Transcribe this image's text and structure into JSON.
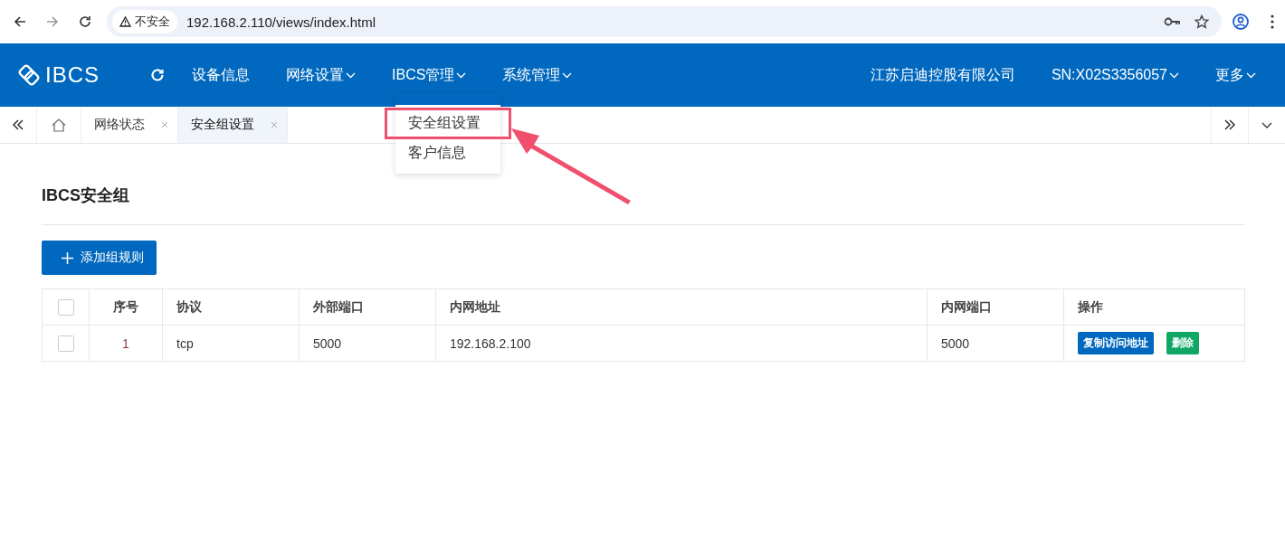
{
  "browser": {
    "security_label": "不安全",
    "url": "192.168.2.110/views/index.html"
  },
  "nav": {
    "logo": "IBCS",
    "items": [
      {
        "label": "设备信息",
        "has_menu": false
      },
      {
        "label": "网络设置",
        "has_menu": true
      },
      {
        "label": "IBCS管理",
        "has_menu": true
      },
      {
        "label": "系统管理",
        "has_menu": true
      }
    ],
    "company": "江苏启迪控股有限公司",
    "sn": "SN:X02S3356057",
    "more": "更多"
  },
  "dropdown": {
    "items": [
      {
        "label": "安全组设置",
        "selected": true
      },
      {
        "label": "客户信息",
        "selected": false
      }
    ]
  },
  "tabs": [
    {
      "label": "网络状态",
      "selected": false
    },
    {
      "label": "安全组设置",
      "selected": true
    }
  ],
  "page": {
    "title": "IBCS安全组",
    "add_button": "添加组规则"
  },
  "table": {
    "select_all_checked": false,
    "columns": [
      "序号",
      "协议",
      "外部端口",
      "内网地址",
      "内网端口",
      "操作"
    ],
    "rows": [
      {
        "checked": false,
        "cells": [
          "1",
          "tcp",
          "5000",
          "192.168.2.100",
          "5000"
        ],
        "actions": [
          {
            "label": "复制访问地址",
            "kind": "copy"
          },
          {
            "label": "删除",
            "kind": "delete"
          }
        ]
      }
    ]
  }
}
